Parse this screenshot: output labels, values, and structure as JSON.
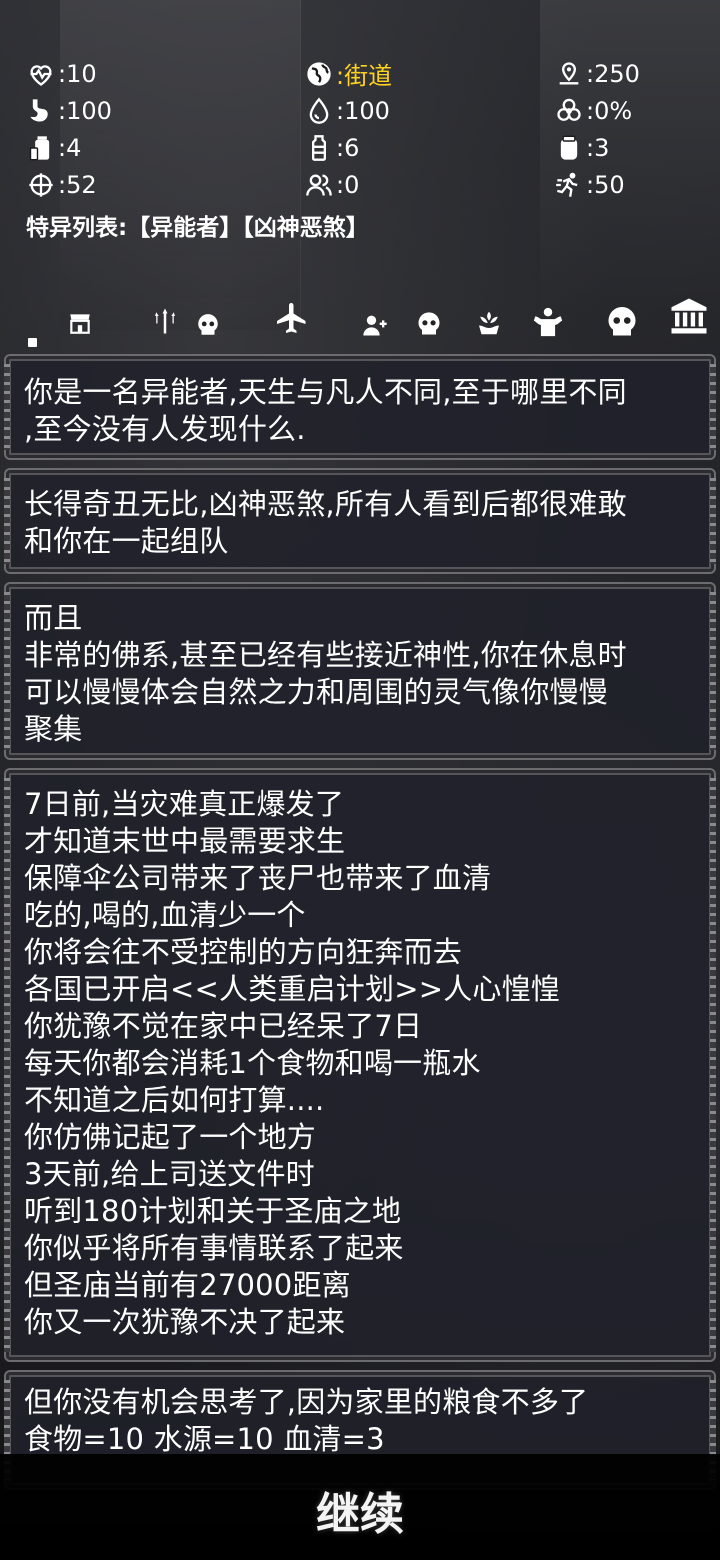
{
  "stats": [
    {
      "icon": "heart-pulse-icon",
      "value": ":10"
    },
    {
      "icon": "globe-icon",
      "value": ":街道",
      "color": "#ffd21e"
    },
    {
      "icon": "map-pin-icon",
      "value": ":250"
    },
    {
      "icon": "stomach-icon",
      "value": ":100"
    },
    {
      "icon": "water-drop-icon",
      "value": ":100"
    },
    {
      "icon": "biohazard-icon",
      "value": ":0%"
    },
    {
      "icon": "food-can-icon",
      "value": ":4"
    },
    {
      "icon": "bottle-icon",
      "value": ":6"
    },
    {
      "icon": "serum-jar-icon",
      "value": ":3"
    },
    {
      "icon": "crosshair-icon",
      "value": ":52"
    },
    {
      "icon": "people-icon",
      "value": ":0"
    },
    {
      "icon": "running-icon",
      "value": ":50"
    }
  ],
  "special": {
    "label": "特异列表:",
    "traits": [
      "【异能者】",
      "【凶神恶煞】"
    ]
  },
  "toolbar": [
    "shop-icon",
    "trident-icon",
    "skull-icon",
    "airplane-icon",
    "add-user-icon",
    "skull-icon",
    "lotus-hands-icon",
    "muscle-icon",
    "skull-icon",
    "bank-icon"
  ],
  "panels": [
    {
      "text": "你是一名异能者,天生与凡人不同,至于哪里不同\n,至今没有人发现什么."
    },
    {
      "text": "长得奇丑无比,凶神恶煞,所有人看到后都很难敢\n和你在一起组队"
    },
    {
      "text": "而且\n非常的佛系,甚至已经有些接近神性,你在休息时\n可以慢慢体会自然之力和周围的灵气像你慢慢\n聚集"
    },
    {
      "text": "7日前,当灾难真正爆发了\n才知道末世中最需要求生\n保障伞公司带来了丧尸也带来了血清\n吃的,喝的,血清少一个\n你将会往不受控制的方向狂奔而去\n各国已开启<<人类重启计划>>人心惶惶\n你犹豫不觉在家中已经呆了7日\n每天你都会消耗1个食物和喝一瓶水\n不知道之后如何打算....\n你仿佛记起了一个地方\n3天前,给上司送文件时\n听到180计划和关于圣庙之地\n你似乎将所有事情联系了起来\n但圣庙当前有27000距离\n你又一次犹豫不决了起来"
    },
    {
      "text": "但你没有机会思考了,因为家里的粮食不多了\n食物=10  水源=10  血清=3"
    }
  ],
  "continue_label": "继续"
}
